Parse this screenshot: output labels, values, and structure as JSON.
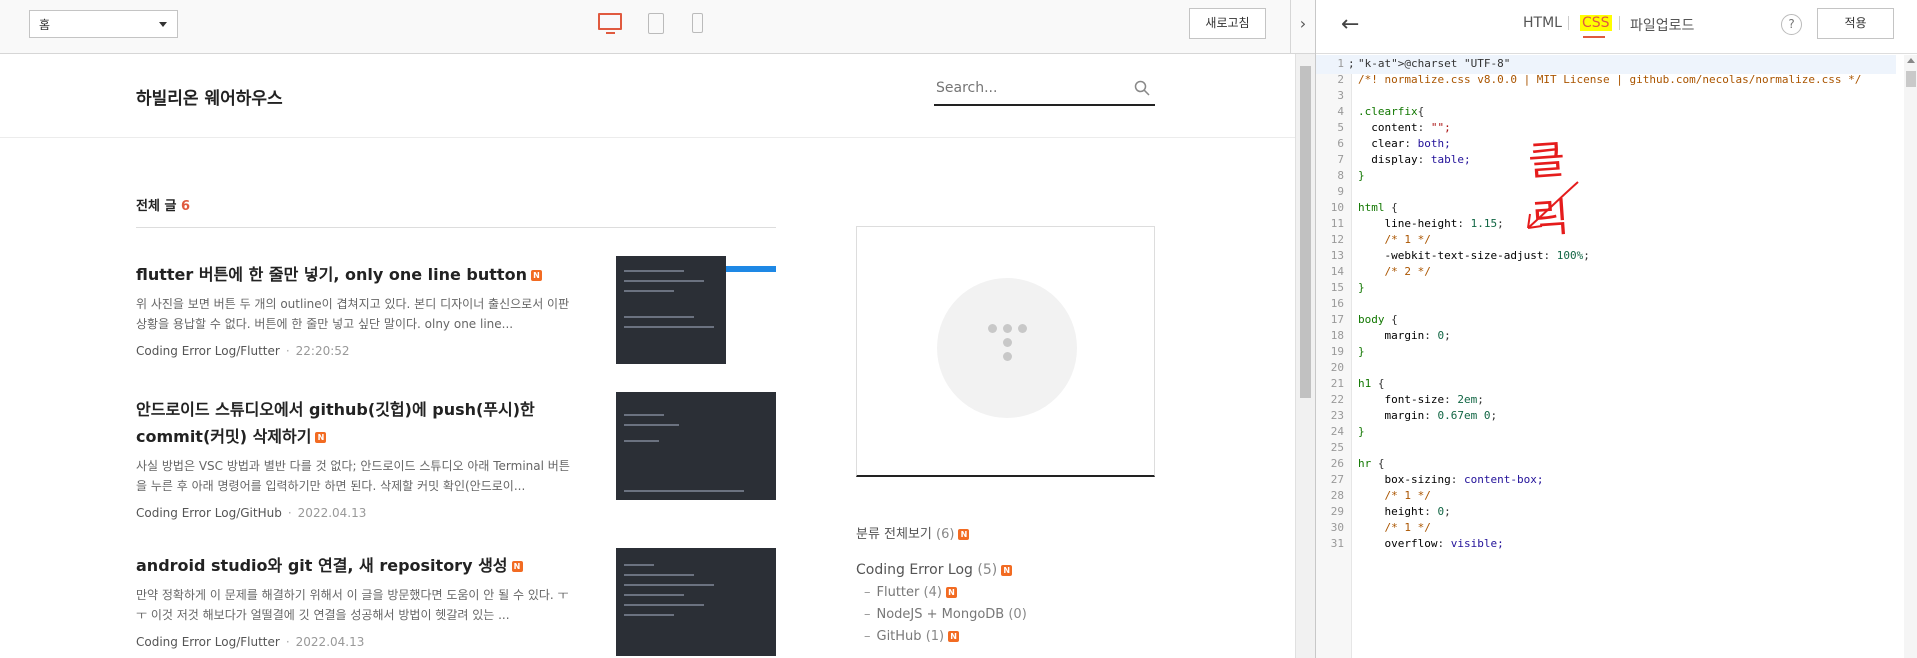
{
  "toolbar": {
    "select_value": "홈",
    "reload_label": "새로고침",
    "collapse_glyph": "›"
  },
  "blog": {
    "title": "하빌리온 웨어하우스",
    "search_placeholder": "Search...",
    "all_posts_label": "전체 글",
    "all_posts_count": "6"
  },
  "posts": [
    {
      "title": "flutter 버튼에 한 줄만 넣기, only one line button",
      "excerpt": "위 사진을 보면 버튼 두 개의 outline이 겹쳐지고 있다. 본디 디자이너 출신으로서 이판 상황을 용납할 수 없다. 버튼에 한 줄만 넣고 싶단 말이다. olny one line...",
      "category": "Coding Error Log/Flutter",
      "time": "22:20:52",
      "badge": "N"
    },
    {
      "title": "안드로이드 스튜디오에서 github(깃헙)에 push(푸시)한 commit(커밋) 삭제하기",
      "excerpt": "사실 방법은 VSC 방법과 별반 다를 것 없다; 안드로이드 스튜디오 아래 Terminal 버튼을 누른 후 아래 명령어를 입력하기만 하면 된다. 삭제할 커밋 확인(안드로이...",
      "category": "Coding Error Log/GitHub",
      "time": "2022.04.13",
      "badge": "N"
    },
    {
      "title": "android studio와 git 연결, 새 repository 생성",
      "excerpt": "만약 정확하게 이 문제를 해결하기 위해서 이 글을 방문했다면 도움이 안 될 수 있다. ㅜㅜ 이것 저것 해보다가 얼떨결에 깃 연결을 성공해서 방법이 헷갈려 있는 ...",
      "category": "Coding Error Log/Flutter",
      "time": "2022.04.13",
      "badge": "N"
    }
  ],
  "categories": {
    "all_label": "분류 전체보기",
    "all_count": "(6)",
    "top_label": "Coding Error Log",
    "top_count": "(5)",
    "subs": [
      {
        "label": "Flutter",
        "count": "(4)",
        "badge": true
      },
      {
        "label": "NodeJS + MongoDB",
        "count": "(0)",
        "badge": false
      },
      {
        "label": "GitHub",
        "count": "(1)",
        "badge": true
      }
    ]
  },
  "editor": {
    "tabs": {
      "html": "HTML",
      "css": "CSS",
      "upload": "파일업로드"
    },
    "help": "?",
    "apply_label": "적용",
    "back_glyph": "←",
    "annotation": "클릭",
    "lines": [
      "@charset \"UTF-8\";",
      "/*! normalize.css v8.0.0 | MIT License | github.com/necolas/normalize.css */",
      "",
      ".clearfix{",
      "  content: \"\";",
      "  clear: both;",
      "  display: table;",
      "}",
      "",
      "html {",
      "    line-height: 1.15;",
      "    /* 1 */",
      "    -webkit-text-size-adjust: 100%;",
      "    /* 2 */",
      "}",
      "",
      "body {",
      "    margin: 0;",
      "}",
      "",
      "h1 {",
      "    font-size: 2em;",
      "    margin: 0.67em 0;",
      "}",
      "",
      "hr {",
      "    box-sizing: content-box;",
      "    /* 1 */",
      "    height: 0;",
      "    /* 1 */",
      "    overflow: visible;"
    ]
  },
  "colors": {
    "accent": "#e05a3f",
    "badge": "#f26b22",
    "annotation": "#e51c1c",
    "highlight": "#ffff00"
  }
}
